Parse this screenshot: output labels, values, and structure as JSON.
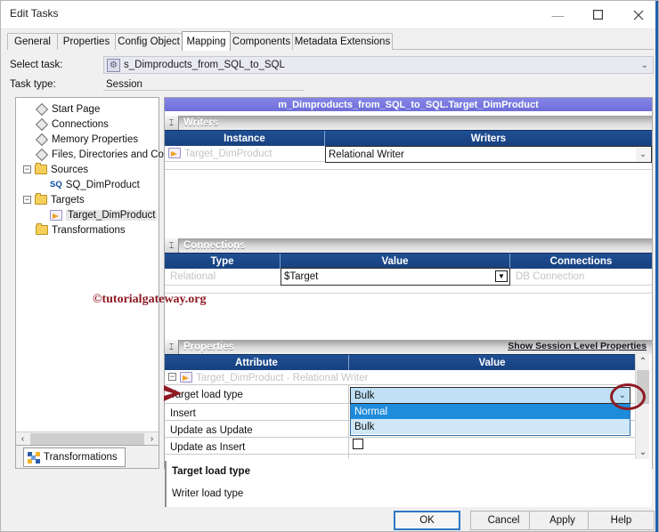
{
  "window": {
    "title": "Edit Tasks",
    "controls": {
      "minimize": "minimize-icon",
      "maximize": "maximize-icon",
      "close": "close-icon"
    }
  },
  "tabs": [
    {
      "label": "General",
      "active": false
    },
    {
      "label": "Properties",
      "active": false
    },
    {
      "label": "Config Object",
      "active": false
    },
    {
      "label": "Mapping",
      "active": true
    },
    {
      "label": "Components",
      "active": false
    },
    {
      "label": "Metadata Extensions",
      "active": false
    }
  ],
  "header": {
    "select_task_label": "Select task:",
    "select_task_value": "s_Dimproducts_from_SQL_to_SQL",
    "task_type_label": "Task type:",
    "task_type_value": "Session"
  },
  "tree": [
    {
      "label": "Start Page",
      "icon": "diamond-icon",
      "indent": 1,
      "toggle": "",
      "selected": false
    },
    {
      "label": "Connections",
      "icon": "diamond-icon",
      "indent": 1,
      "toggle": "",
      "selected": false
    },
    {
      "label": "Memory Properties",
      "icon": "diamond-icon",
      "indent": 1,
      "toggle": "",
      "selected": false
    },
    {
      "label": "Files, Directories and Com",
      "icon": "diamond-icon",
      "indent": 1,
      "toggle": "",
      "selected": false
    },
    {
      "label": "Sources",
      "icon": "folder-icon",
      "indent": 0,
      "toggle": "minus",
      "selected": false
    },
    {
      "label": "SQ_DimProduct",
      "icon": "sq-icon",
      "indent": 2,
      "toggle": "",
      "selected": false
    },
    {
      "label": "Targets",
      "icon": "folder-icon",
      "indent": 0,
      "toggle": "minus",
      "selected": false
    },
    {
      "label": "Target_DimProduct",
      "icon": "target-icon",
      "indent": 2,
      "toggle": "",
      "selected": true
    },
    {
      "label": "Transformations",
      "icon": "folder-icon",
      "indent": 1,
      "toggle": "",
      "selected": false
    }
  ],
  "tree_footer": {
    "tab_label": "Transformations",
    "icon": "transformations-icon"
  },
  "mapping_bar": {
    "title": "m_Dimproducts_from_SQL_to_SQL.Target_DimProduct"
  },
  "writers": {
    "section_title": "Writers",
    "columns": [
      "Instance",
      "Writers"
    ],
    "row": {
      "instance": "Target_DimProduct",
      "writer": "Relational Writer"
    }
  },
  "connections": {
    "section_title": "Connections",
    "columns": [
      "Type",
      "Value",
      "Connections"
    ],
    "row": {
      "type": "Relational",
      "value": "$Target",
      "connection": "DB Connection"
    }
  },
  "properties": {
    "section_title": "Properties",
    "session_link": "Show Session Level Properties",
    "columns": [
      "Attribute",
      "Value"
    ],
    "group_row": "Target_DimProduct - Relational Writer",
    "rows": [
      {
        "attribute": "Target load type",
        "value": "Bulk",
        "kind": "dropdown-open"
      },
      {
        "attribute": "Insert",
        "value": "",
        "kind": "checkbox-hidden"
      },
      {
        "attribute": "Update as Update",
        "value": "",
        "kind": "checkbox-checked"
      },
      {
        "attribute": "Update as Insert",
        "value": "",
        "kind": "checkbox"
      }
    ],
    "dropdown_options": [
      "Normal",
      "Bulk"
    ],
    "dropdown_selected": "Bulk",
    "dropdown_highlighted": "Normal"
  },
  "description": {
    "title": "Target load type",
    "body": "Writer load type"
  },
  "buttons": [
    {
      "label": "OK",
      "primary": true
    },
    {
      "label": "Cancel",
      "primary": false
    },
    {
      "label": "Apply",
      "primary": false
    },
    {
      "label": "Help",
      "primary": false
    }
  ],
  "annotations": {
    "watermark": "©tutorialgateway.org",
    "arrow": "red-arrow-annotation",
    "circle": "red-circle-annotation"
  },
  "colors": {
    "accent_blue": "#17407d",
    "mapping_purple": "#7a7ae0",
    "annotation_red": "#8e1b24",
    "highlight_blue": "#1f8bdb"
  }
}
